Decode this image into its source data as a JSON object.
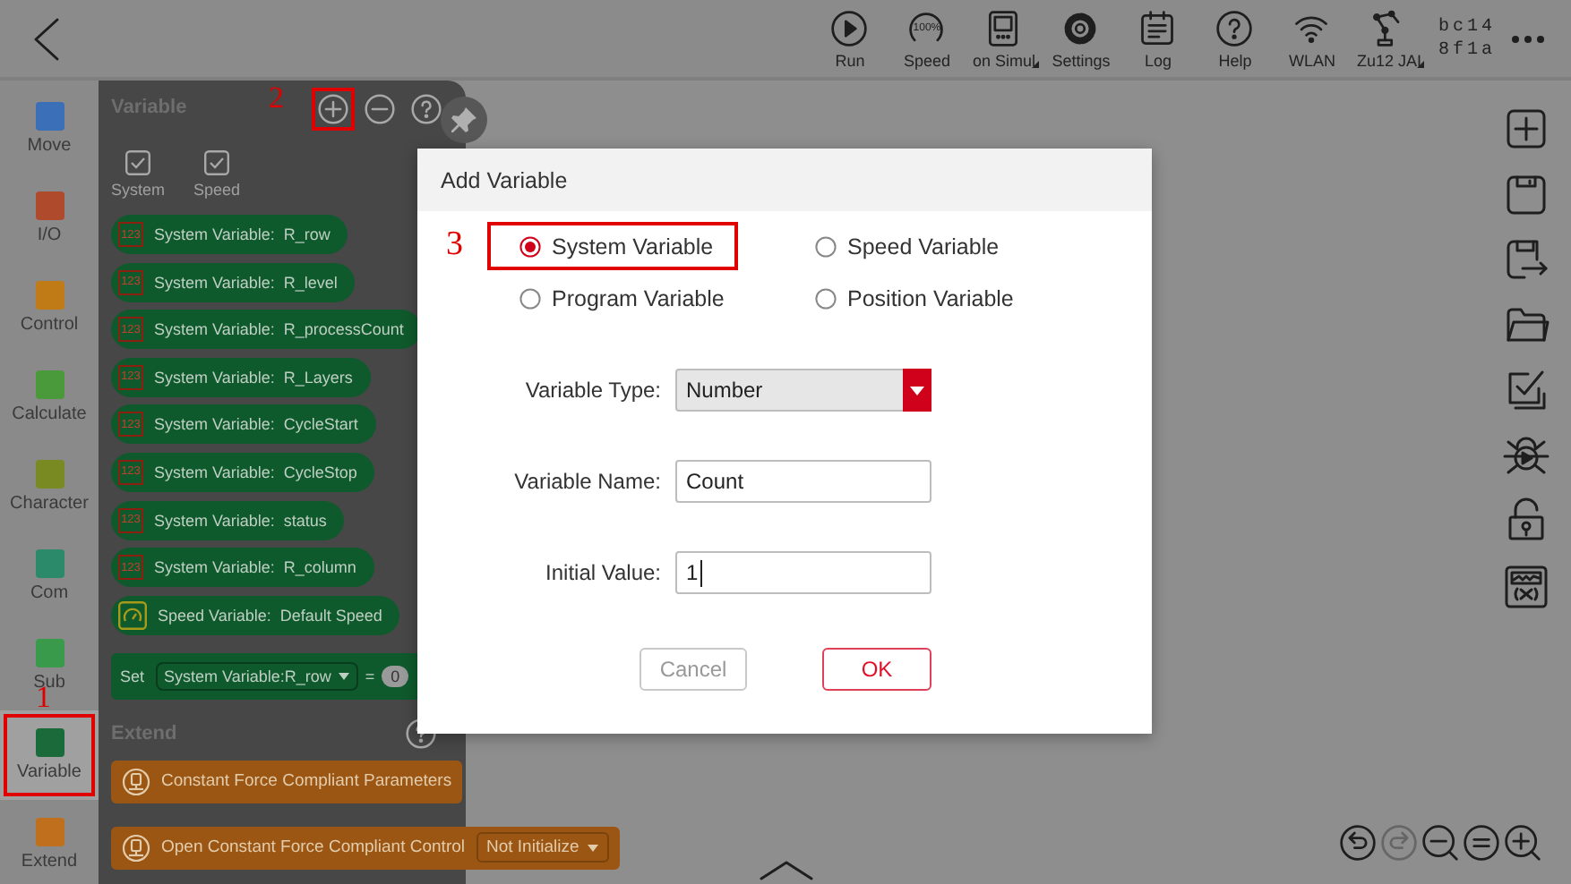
{
  "toolbar": {
    "items": [
      {
        "label": "Run",
        "has_menu": false
      },
      {
        "label": "Speed",
        "gauge_text": "100%",
        "has_menu": false
      },
      {
        "label": "on Simul",
        "has_menu": true
      },
      {
        "label": "Settings",
        "has_menu": false
      },
      {
        "label": "Log",
        "has_menu": false
      },
      {
        "label": "Help",
        "has_menu": false
      },
      {
        "label": "WLAN",
        "has_menu": false
      },
      {
        "label": "Zu12 JAI",
        "has_menu": true
      }
    ],
    "device_id": [
      "bc14",
      "8f1a"
    ]
  },
  "sidebar": {
    "annotation": "1",
    "items": [
      {
        "label": "Move",
        "color": "#3b6fb8",
        "selected": false,
        "highlighted": false
      },
      {
        "label": "I/O",
        "color": "#b04a2c",
        "selected": false,
        "highlighted": false
      },
      {
        "label": "Control",
        "color": "#c07a16",
        "selected": false,
        "highlighted": false
      },
      {
        "label": "Calculate",
        "color": "#4a9a3c",
        "selected": false,
        "highlighted": false
      },
      {
        "label": "Character",
        "color": "#7a8a22",
        "selected": false,
        "highlighted": false
      },
      {
        "label": "Com",
        "color": "#2a8a6a",
        "selected": false,
        "highlighted": false
      },
      {
        "label": "Sub",
        "color": "#3a9a4c",
        "selected": false,
        "highlighted": false
      },
      {
        "label": "Variable",
        "color": "#1a6a3a",
        "selected": true,
        "highlighted": true
      },
      {
        "label": "Extend",
        "color": "#c0701c",
        "selected": false,
        "highlighted": false
      }
    ]
  },
  "palette": {
    "title": "Variable",
    "annotation": "2",
    "add_highlighted": true,
    "filters": [
      {
        "label": "System",
        "checked": true
      },
      {
        "label": "Speed",
        "checked": true
      }
    ],
    "blocks": [
      {
        "kind": "system",
        "badge": "123",
        "text": "System Variable:  R_row"
      },
      {
        "kind": "system",
        "badge": "123",
        "text": "System Variable:  R_level"
      },
      {
        "kind": "system",
        "badge": "123",
        "text": "System Variable:  R_processCount"
      },
      {
        "kind": "system",
        "badge": "123",
        "text": "System Variable:  R_Layers"
      },
      {
        "kind": "system",
        "badge": "123",
        "text": "System Variable:  CycleStart"
      },
      {
        "kind": "system",
        "badge": "123",
        "text": "System Variable:  CycleStop"
      },
      {
        "kind": "system",
        "badge": "123",
        "text": "System Variable:  status"
      },
      {
        "kind": "system",
        "badge": "123",
        "text": "System Variable:  R_column"
      },
      {
        "kind": "speed",
        "text": "Speed Variable:  Default Speed"
      }
    ],
    "set_block": {
      "label": "Set",
      "variable": "System Variable:R_row",
      "operator": "=",
      "value": "0"
    },
    "extend": {
      "title": "Extend",
      "blocks": [
        {
          "text": "Constant Force Compliant Parameters"
        },
        {
          "text": "Open Constant Force Compliant Control",
          "option": "Not Initialize"
        }
      ]
    }
  },
  "dialog": {
    "title": "Add Variable",
    "annotation": "3",
    "radios": [
      {
        "label": "System Variable",
        "selected": true,
        "highlighted": true
      },
      {
        "label": "Speed Variable",
        "selected": false,
        "highlighted": false
      },
      {
        "label": "Program Variable",
        "selected": false,
        "highlighted": false
      },
      {
        "label": "Position Variable",
        "selected": false,
        "highlighted": false
      }
    ],
    "fields": [
      {
        "kind": "select",
        "label": "Variable Type:",
        "value": "Number"
      },
      {
        "kind": "text",
        "label": "Variable Name:",
        "value": "Count"
      },
      {
        "kind": "text",
        "label": "Initial Value:",
        "value": "1"
      }
    ],
    "buttons": [
      {
        "kind": "cancel",
        "label": "Cancel"
      },
      {
        "kind": "ok",
        "label": "OK"
      }
    ]
  }
}
